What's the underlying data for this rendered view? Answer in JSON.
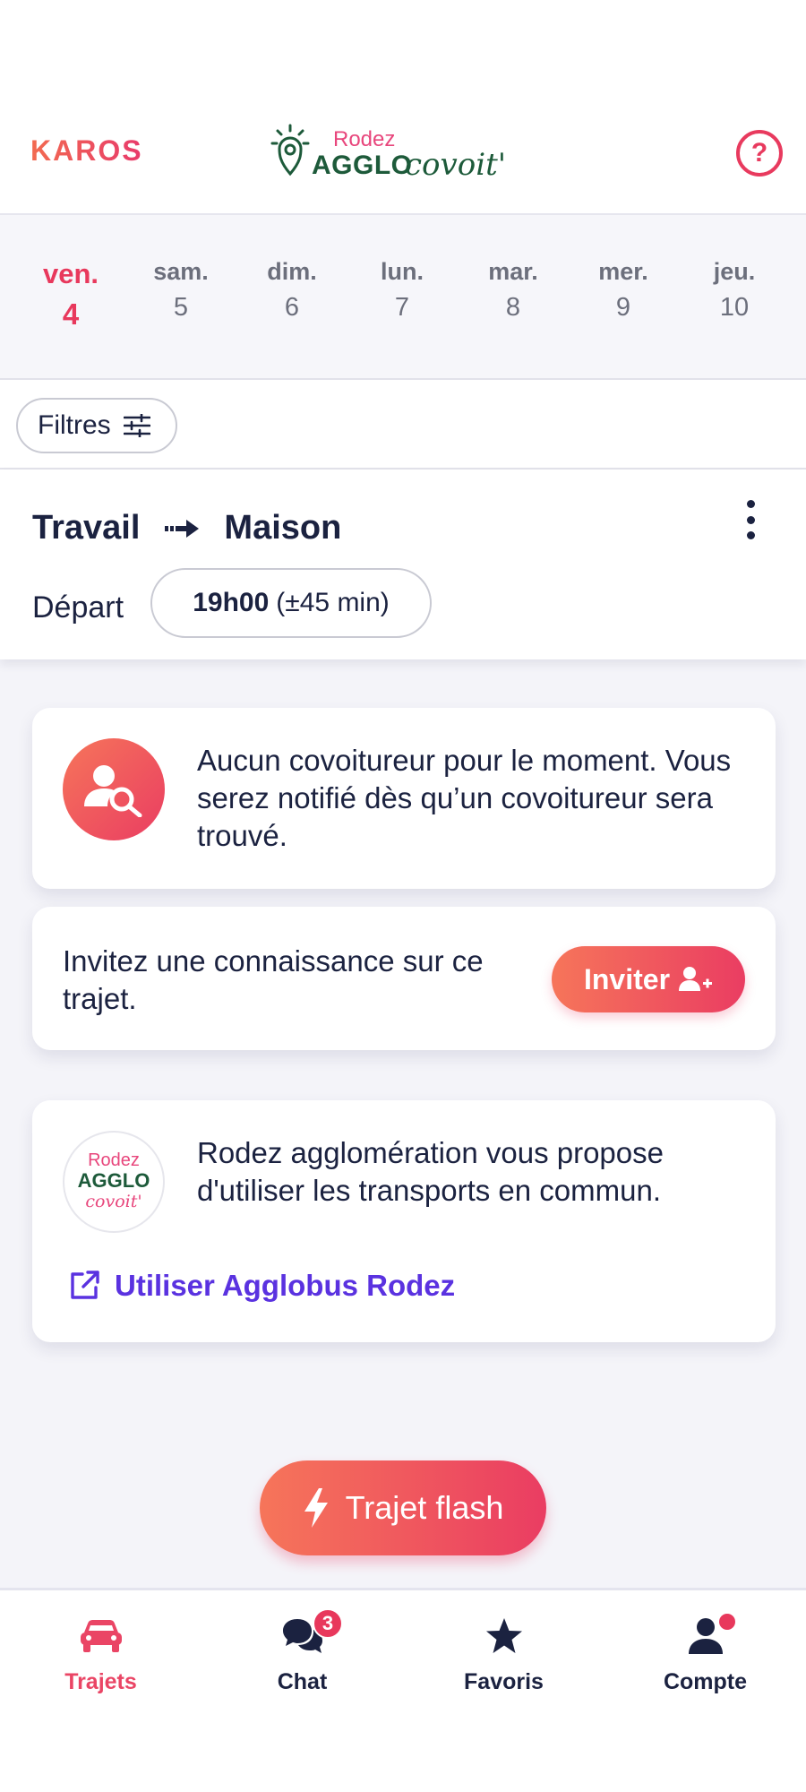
{
  "header": {
    "app_logo": "KAROS",
    "brand": {
      "line1": "Rodez",
      "line2": "AGGLO",
      "line3": "covoit'"
    },
    "help_icon": "question-circle-icon"
  },
  "days": [
    {
      "name": "ven.",
      "num": "4",
      "active": true
    },
    {
      "name": "sam.",
      "num": "5"
    },
    {
      "name": "dim.",
      "num": "6"
    },
    {
      "name": "lun.",
      "num": "7"
    },
    {
      "name": "mar.",
      "num": "8"
    },
    {
      "name": "mer.",
      "num": "9"
    },
    {
      "name": "jeu.",
      "num": "10"
    }
  ],
  "filters": {
    "label": "Filtres"
  },
  "route": {
    "from": "Travail",
    "to": "Maison",
    "depart_label": "Départ",
    "time": "19h00",
    "tolerance": "(±45 min)"
  },
  "cards": {
    "no_match": "Aucun covoitureur pour le moment. Vous serez notifié dès qu’un covoitureur sera trouvé.",
    "invite_text": "Invitez une connaissance sur ce trajet.",
    "invite_button": "Inviter",
    "transit_text": "Rodez agglomération vous propose d'utiliser les transports en commun.",
    "transit_link": "Utiliser Agglobus Rodez"
  },
  "flash_button": "Trajet flash",
  "nav": {
    "items": [
      {
        "label": "Trajets",
        "icon": "car-icon",
        "active": true
      },
      {
        "label": "Chat",
        "icon": "chat-icon",
        "badge": "3"
      },
      {
        "label": "Favoris",
        "icon": "star-icon"
      },
      {
        "label": "Compte",
        "icon": "user-icon",
        "dot": true
      }
    ]
  },
  "colors": {
    "accent": "#e8385c",
    "gradient_start": "#f6755a",
    "gradient_end": "#ea3d62",
    "link": "#5a32e0",
    "brand_green": "#1d5a3a"
  }
}
